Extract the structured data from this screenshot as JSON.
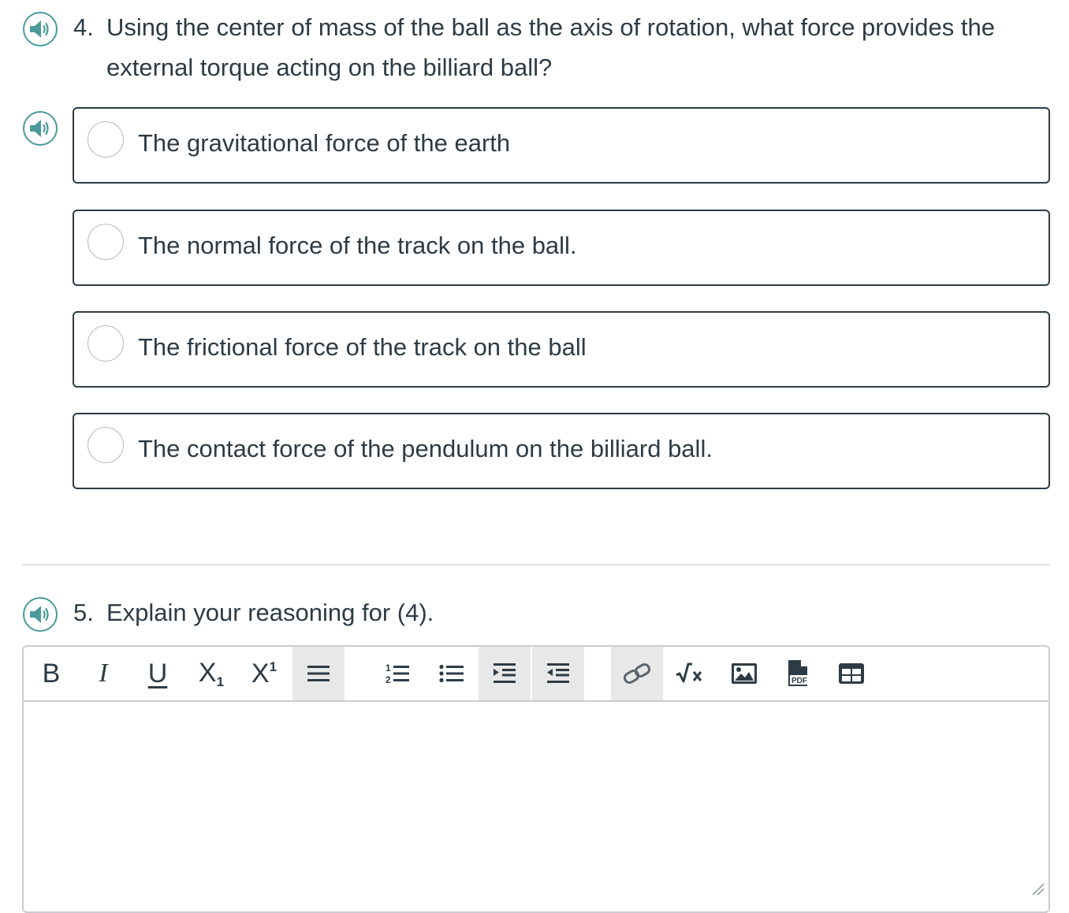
{
  "question4": {
    "number": "4.",
    "line1": "Using the center of mass of the ball as the axis of rotation, what force provides the",
    "line2": "external torque acting on the billiard ball?",
    "options": [
      {
        "label": "The gravitational force of the earth"
      },
      {
        "label": "The normal force of the track on the ball."
      },
      {
        "label": "The frictional force of the track on the ball"
      },
      {
        "label": "The contact force of the pendulum on the billiard ball."
      }
    ]
  },
  "question5": {
    "number": "5.",
    "text": "Explain your reasoning for (4)."
  },
  "toolbar": {
    "bold": "B",
    "italic": "I",
    "underline": "U",
    "subscript_base": "X",
    "subscript_mark": "1",
    "superscript_base": "X",
    "superscript_mark": "1",
    "numbered_list_digits": [
      "1",
      "2"
    ],
    "pdf_label": "PDF"
  },
  "icons": {
    "speaker": "speaker-icon",
    "align": "align-menu-icon",
    "ordered_list": "ordered-list-icon",
    "bullet_list": "bullet-list-icon",
    "indent": "indent-icon",
    "outdent": "outdent-icon",
    "link": "link-icon",
    "math": "math-equation-icon",
    "image": "image-icon",
    "document": "pdf-document-icon",
    "table": "table-icon",
    "resize": "resize-handle-icon"
  },
  "colors": {
    "accent": "#4a9a9a",
    "text": "#2d3b45",
    "option_border": "#2d3b45",
    "radio_border": "#b5bcc2",
    "divider": "#dfe3e6",
    "toolbar_shade": "#e8e8e8"
  }
}
